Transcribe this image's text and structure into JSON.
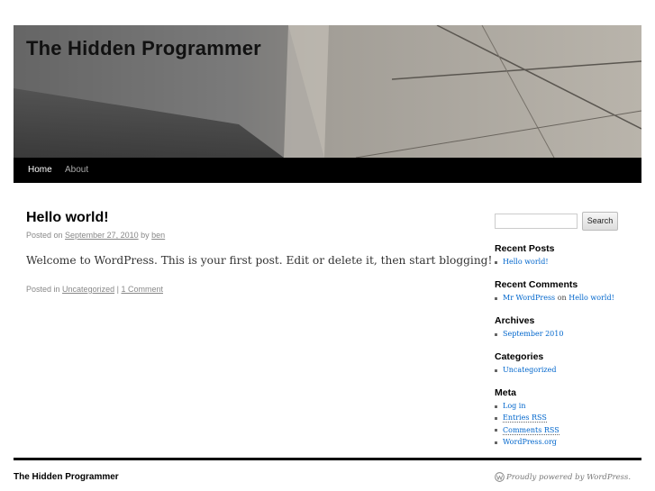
{
  "site": {
    "title": "The Hidden Programmer"
  },
  "nav": {
    "items": [
      {
        "label": "Home"
      },
      {
        "label": "About"
      }
    ]
  },
  "post": {
    "title": "Hello world!",
    "meta_prefix": "Posted on",
    "date": "September 27, 2010",
    "by": "by",
    "author": "ben",
    "body": "Welcome to WordPress. This is your first post. Edit or delete it, then start blogging!",
    "posted_in": "Posted in",
    "category": "Uncategorized",
    "separator": "|",
    "comments": "1 Comment"
  },
  "sidebar": {
    "search_button": "Search",
    "recent_posts": {
      "title": "Recent Posts",
      "items": [
        "Hello world!"
      ]
    },
    "recent_comments": {
      "title": "Recent Comments",
      "author": "Mr WordPress",
      "on": "on",
      "post": "Hello world!"
    },
    "archives": {
      "title": "Archives",
      "items": [
        "September 2010"
      ]
    },
    "categories": {
      "title": "Categories",
      "items": [
        "Uncategorized"
      ]
    },
    "meta": {
      "title": "Meta",
      "items": [
        "Log in",
        "Entries RSS",
        "Comments RSS",
        "WordPress.org"
      ]
    }
  },
  "footer": {
    "title": "The Hidden Programmer",
    "powered": "Proudly powered by WordPress."
  }
}
